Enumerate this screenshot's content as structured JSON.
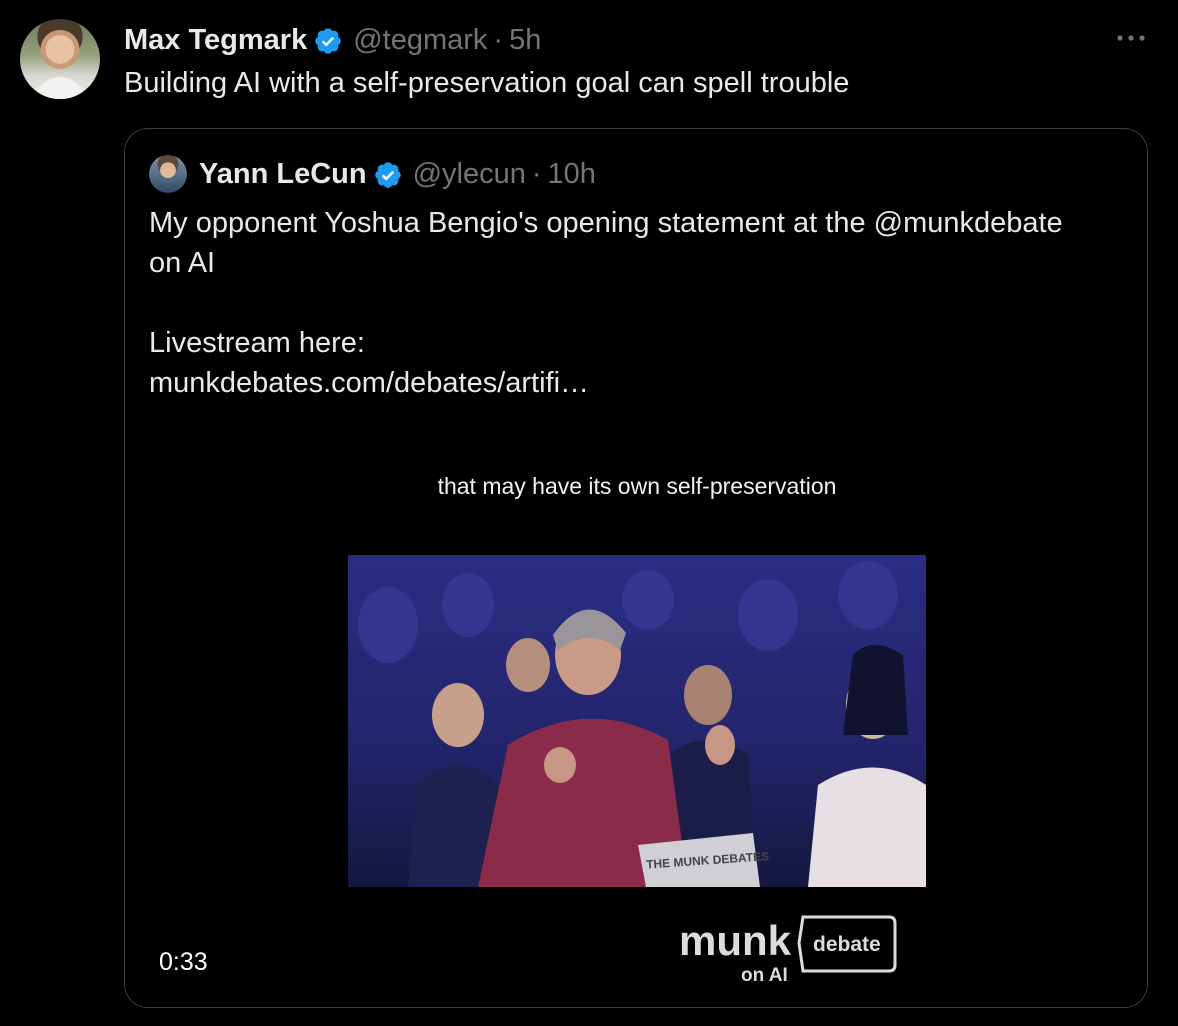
{
  "tweet": {
    "author_name": "Max Tegmark",
    "author_handle": "@tegmark",
    "separator": "·",
    "time": "5h",
    "text": "Building AI with a self-preservation goal can spell trouble",
    "more_icon": "more-horizontal-icon"
  },
  "quoted": {
    "author_name": "Yann LeCun",
    "author_handle": "@ylecun",
    "separator": "·",
    "time": "10h",
    "text_lines": [
      "My opponent Yoshua Bengio's opening statement at the @munkdebate",
      "on AI",
      "",
      "Livestream here:",
      "munkdebates.com/debates/artifi…"
    ],
    "video": {
      "caption": "that may have its own self-preservation",
      "podium_label": "THE MUNK DEBATES",
      "logo_word": "munk",
      "logo_badge": "debate",
      "logo_sub": "on AI",
      "duration": "0:33"
    }
  },
  "colors": {
    "background": "#000000",
    "text_primary": "#e7e9ea",
    "text_secondary": "#71767b",
    "verified": "#1d9bf0",
    "border": "#3c3f43"
  }
}
